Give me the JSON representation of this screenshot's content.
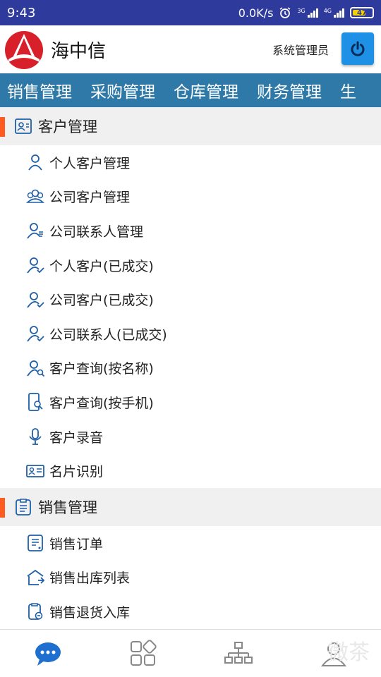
{
  "status_bar": {
    "time": "9:43",
    "speed": "0.0K/s",
    "net1": "3G",
    "net2": "4G",
    "battery": "47"
  },
  "header": {
    "app_name": "海中信",
    "user_role": "系统管理员"
  },
  "top_nav": [
    "销售管理",
    "采购管理",
    "仓库管理",
    "财务管理",
    "生"
  ],
  "sections": [
    {
      "title": "客户管理",
      "items": [
        {
          "label": "个人客户管理",
          "icon": "person-icon"
        },
        {
          "label": "公司客户管理",
          "icon": "group-icon"
        },
        {
          "label": "公司联系人管理",
          "icon": "contact-person-icon"
        },
        {
          "label": "个人客户(已成交)",
          "icon": "person-check-icon"
        },
        {
          "label": "公司客户(已成交)",
          "icon": "person-check-icon"
        },
        {
          "label": "公司联系人(已成交)",
          "icon": "person-check-icon"
        },
        {
          "label": "客户查询(按名称)",
          "icon": "person-search-icon"
        },
        {
          "label": "客户查询(按手机)",
          "icon": "phone-search-icon"
        },
        {
          "label": "客户录音",
          "icon": "microphone-icon"
        },
        {
          "label": "名片识别",
          "icon": "business-card-icon"
        }
      ]
    },
    {
      "title": "销售管理",
      "items": [
        {
          "label": "销售订单",
          "icon": "order-list-icon"
        },
        {
          "label": "销售出库列表",
          "icon": "warehouse-out-icon"
        },
        {
          "label": "销售退货入库",
          "icon": "return-goods-icon"
        }
      ]
    }
  ],
  "watermark": "微茶",
  "colors": {
    "status_bar": "#2e3a9c",
    "nav_bar": "#2f79a8",
    "accent_bar": "#ff5a1f",
    "power_button": "#1e90e6",
    "icon_blue": "#1e5fa8"
  }
}
